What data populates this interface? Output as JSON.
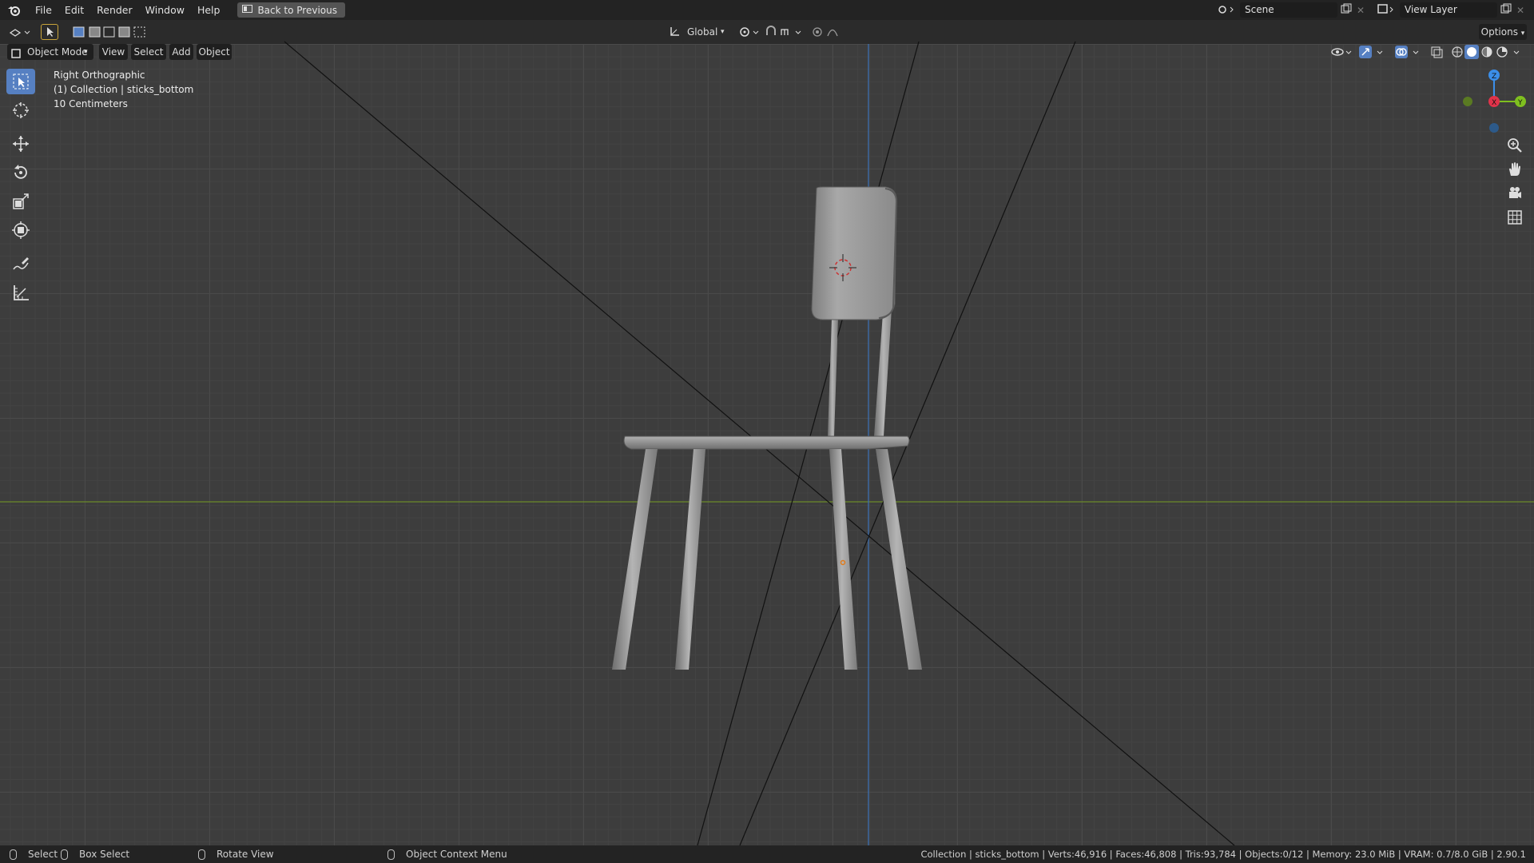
{
  "topbar": {
    "menus": [
      "File",
      "Edit",
      "Render",
      "Window",
      "Help"
    ],
    "back_button": "Back to Previous",
    "scene": "Scene",
    "view_layer": "View Layer"
  },
  "header": {
    "orientation": "Global",
    "options": "Options"
  },
  "viewport_header": {
    "mode": "Object Mode",
    "menus": [
      "View",
      "Select",
      "Add",
      "Object"
    ]
  },
  "overlay": {
    "view_name": "Right Orthographic",
    "collection": "(1) Collection | sticks_bottom",
    "scale": "10 Centimeters"
  },
  "status": {
    "select": "Select",
    "box_select": "Box Select",
    "rotate_view": "Rotate View",
    "context_menu": "Object Context Menu",
    "stats": "Collection | sticks_bottom | Verts:46,916 | Faces:46,808 | Tris:93,784 | Objects:0/12 | Memory: 23.0 MiB | VRAM: 0.7/8.0 GiB | 2.90.1"
  },
  "colors": {
    "accent": "#5680c2",
    "x_axis": "#e0334a",
    "y_axis": "#7fbf1f",
    "z_axis": "#3b8ee8"
  },
  "icons": [
    "blender-logo-icon",
    "select-box-icon",
    "cursor-icon",
    "move-icon",
    "rotate-icon",
    "scale-icon",
    "transform-icon",
    "annotate-icon",
    "measure-icon",
    "zoom-icon",
    "hand-icon",
    "camera-icon",
    "grid-icon"
  ]
}
